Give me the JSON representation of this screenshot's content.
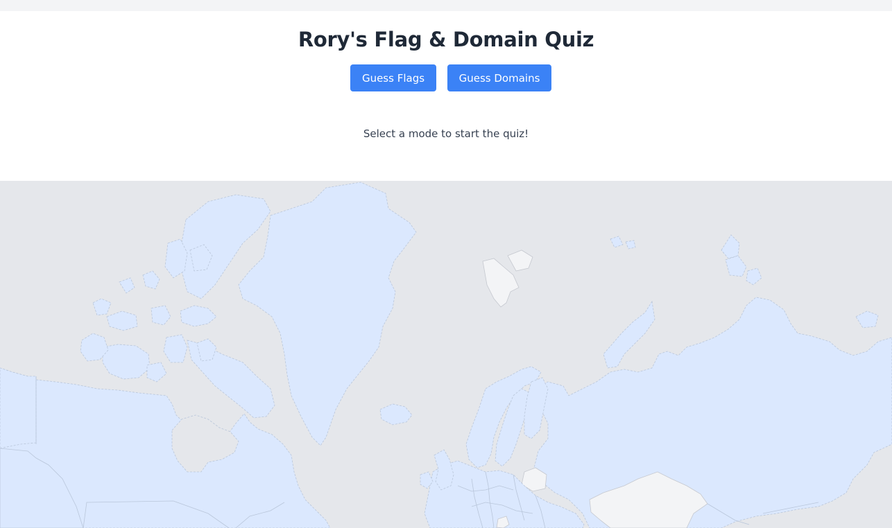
{
  "app": {
    "title": "Rory's Flag & Domain Quiz"
  },
  "modes": {
    "flags_label": "Guess Flags",
    "domains_label": "Guess Domains"
  },
  "status": {
    "message": "Select a mode to start the quiz!"
  },
  "colors": {
    "accent": "#3b82f6",
    "ocean": "#e5e7eb",
    "land": "#dbe8fe",
    "unowned_land": "#f3f4f6"
  }
}
